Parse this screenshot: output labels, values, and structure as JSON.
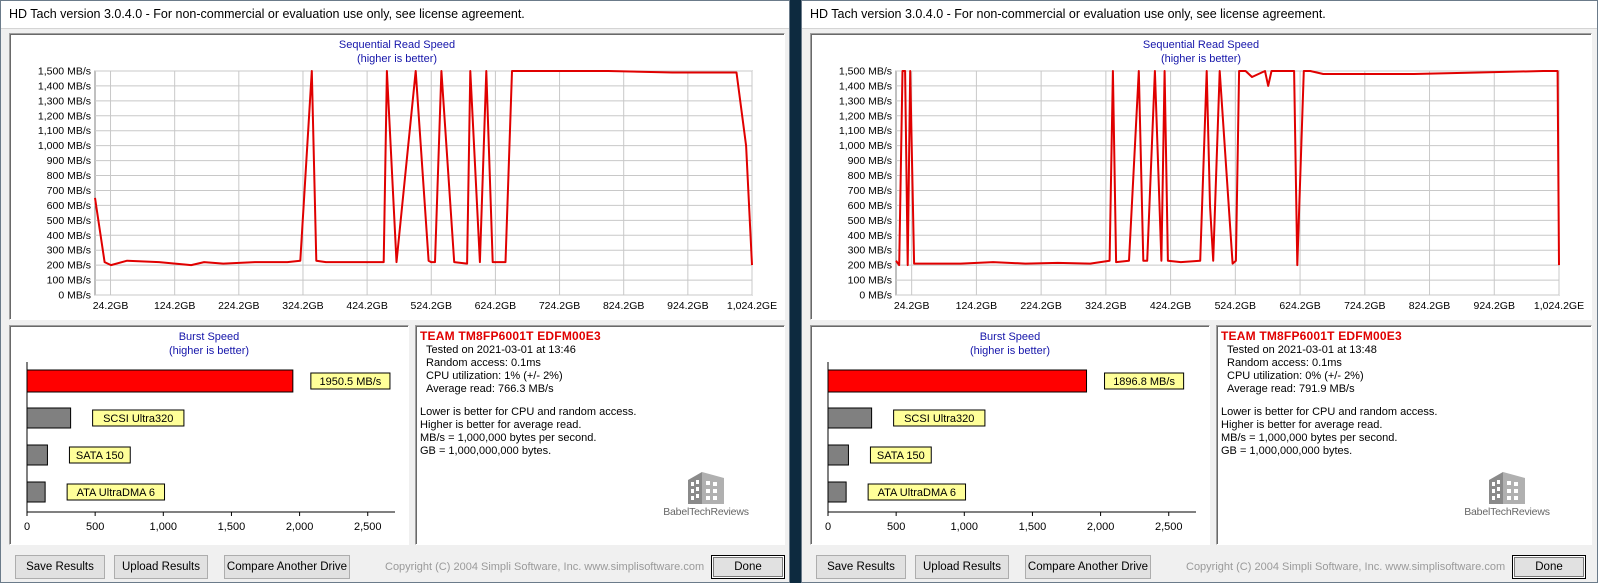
{
  "windows": [
    {
      "title": "HD Tach version 3.0.4.0  - For non-commercial or evaluation use only, see license agreement.",
      "seq_title": "Sequential Read Speed",
      "seq_subtitle": "(higher is better)",
      "burst_title": "Burst Speed",
      "burst_subtitle": "(higher is better)",
      "drive_name": "TEAM TM8FP6001T EDFM00E3",
      "info_lines": [
        "Tested on 2021-03-01 at 13:46",
        "Random access: 0.1ms",
        "CPU utilization: 1% (+/- 2%)",
        "Average read: 766.3 MB/s"
      ],
      "notes": [
        "Lower is better for CPU and random access.",
        "Higher is better for average read.",
        "MB/s = 1,000,000 bytes per second.",
        "GB = 1,000,000,000 bytes."
      ],
      "logo_text": "BabelTechReviews",
      "buttons": {
        "save": "Save Results",
        "upload": "Upload Results",
        "compare": "Compare Another Drive",
        "done": "Done"
      },
      "copyright": "Copyright (C) 2004 Simpli Software, Inc. www.simplisoftware.com"
    },
    {
      "title": "HD Tach version 3.0.4.0  - For non-commercial or evaluation use only, see license agreement.",
      "seq_title": "Sequential Read Speed",
      "seq_subtitle": "(higher is better)",
      "burst_title": "Burst Speed",
      "burst_subtitle": "(higher is better)",
      "drive_name": "TEAM TM8FP6001T EDFM00E3",
      "info_lines": [
        "Tested on 2021-03-01 at 13:48",
        "Random access: 0.1ms",
        "CPU utilization: 0% (+/- 2%)",
        "Average read: 791.9 MB/s"
      ],
      "notes": [
        "Lower is better for CPU and random access.",
        "Higher is better for average read.",
        "MB/s = 1,000,000 bytes per second.",
        "GB = 1,000,000,000 bytes."
      ],
      "logo_text": "BabelTechReviews",
      "buttons": {
        "save": "Save Results",
        "upload": "Upload Results",
        "compare": "Compare Another Drive",
        "done": "Done"
      },
      "copyright": "Copyright (C) 2004 Simpli Software, Inc. www.simplisoftware.com"
    }
  ],
  "chart_data": [
    {
      "type": "line",
      "title": "Sequential Read Speed",
      "subtitle": "(higher is better)",
      "ylim": [
        0,
        1500
      ],
      "xlim": [
        0,
        1024.2
      ],
      "y_ticks": [
        0,
        100,
        200,
        300,
        400,
        500,
        600,
        700,
        800,
        900,
        1000,
        1100,
        1200,
        1300,
        1400,
        1500
      ],
      "y_tick_labels": [
        "0 MB/s",
        "100 MB/s",
        "200 MB/s",
        "300 MB/s",
        "400 MB/s",
        "500 MB/s",
        "600 MB/s",
        "700 MB/s",
        "800 MB/s",
        "900 MB/s",
        "1,000 MB/s",
        "1,100 MB/s",
        "1,200 MB/s",
        "1,300 MB/s",
        "1,400 MB/s",
        "1,500 MB/s"
      ],
      "x_ticks": [
        24.2,
        124.2,
        224.2,
        324.2,
        424.2,
        524.2,
        624.2,
        724.2,
        824.2,
        924.2,
        1024.2
      ],
      "x_tick_labels": [
        "24.2GB",
        "124.2GB",
        "224.2GB",
        "324.2GB",
        "424.2GB",
        "524.2GB",
        "624.2GB",
        "724.2GB",
        "824.2GB",
        "924.2GB",
        "1,024.2GE"
      ],
      "grid": true,
      "series": [
        {
          "color": "#e00000",
          "x": [
            0,
            15,
            25,
            50,
            100,
            150,
            170,
            200,
            250,
            300,
            320,
            338,
            345,
            360,
            370,
            385,
            450,
            455,
            470,
            500,
            520,
            524,
            530,
            540,
            560,
            580,
            585,
            600,
            610,
            620,
            640,
            650,
            700,
            800,
            900,
            1000,
            1015,
            1024.2
          ],
          "y": [
            650,
            220,
            200,
            230,
            220,
            200,
            220,
            210,
            220,
            220,
            230,
            1500,
            230,
            220,
            220,
            220,
            220,
            1500,
            220,
            1500,
            230,
            220,
            220,
            1500,
            220,
            210,
            1500,
            220,
            1500,
            220,
            220,
            1500,
            1500,
            1500,
            1490,
            1490,
            1000,
            200
          ]
        }
      ]
    },
    {
      "type": "line",
      "title": "Sequential Read Speed",
      "subtitle": "(higher is better)",
      "ylim": [
        0,
        1500
      ],
      "xlim": [
        0,
        1024.2
      ],
      "y_ticks": [
        0,
        100,
        200,
        300,
        400,
        500,
        600,
        700,
        800,
        900,
        1000,
        1100,
        1200,
        1300,
        1400,
        1500
      ],
      "y_tick_labels": [
        "0 MB/s",
        "100 MB/s",
        "200 MB/s",
        "300 MB/s",
        "400 MB/s",
        "500 MB/s",
        "600 MB/s",
        "700 MB/s",
        "800 MB/s",
        "900 MB/s",
        "1,000 MB/s",
        "1,100 MB/s",
        "1,200 MB/s",
        "1,300 MB/s",
        "1,400 MB/s",
        "1,500 MB/s"
      ],
      "x_ticks": [
        24.2,
        124.2,
        224.2,
        324.2,
        424.2,
        524.2,
        624.2,
        724.2,
        824.2,
        924.2,
        1024.2
      ],
      "x_tick_labels": [
        "24.2GB",
        "124.2GB",
        "224.2GB",
        "324.2GB",
        "424.2GB",
        "524.2GB",
        "624.2GB",
        "724.2GB",
        "824.2GB",
        "924.2GB",
        "1,024.2GE"
      ],
      "grid": true,
      "series": [
        {
          "color": "#e00000",
          "x": [
            0,
            5,
            10,
            14,
            18,
            22,
            28,
            35,
            60,
            100,
            150,
            200,
            250,
            300,
            330,
            335,
            340,
            360,
            375,
            382,
            388,
            400,
            410,
            415,
            420,
            440,
            470,
            480,
            485,
            490,
            500,
            520,
            525,
            530,
            540,
            550,
            570,
            575,
            580,
            600,
            615,
            620,
            630,
            640,
            660,
            700,
            800,
            900,
            1000,
            1022,
            1024.2
          ],
          "y": [
            230,
            200,
            1500,
            1500,
            200,
            1500,
            210,
            210,
            210,
            210,
            220,
            210,
            215,
            210,
            230,
            1500,
            220,
            230,
            1500,
            230,
            230,
            1500,
            230,
            1500,
            230,
            220,
            230,
            1500,
            600,
            230,
            1500,
            210,
            230,
            1500,
            1500,
            1460,
            1500,
            1400,
            1500,
            1500,
            1500,
            200,
            1500,
            1500,
            1480,
            1480,
            1480,
            1490,
            1500,
            1500,
            200
          ]
        }
      ]
    },
    {
      "type": "bar",
      "title": "Burst Speed",
      "subtitle": "(higher is better)",
      "orientation": "horizontal",
      "xlim": [
        0,
        2700
      ],
      "x_ticks": [
        0,
        500,
        1000,
        1500,
        2000,
        2500
      ],
      "x_tick_labels": [
        "0",
        "500",
        "1,000",
        "1,500",
        "2,000",
        "2,500"
      ],
      "categories": [
        "1950.5 MB/s",
        "SCSI Ultra320",
        "SATA 150",
        "ATA UltraDMA 6"
      ],
      "values": [
        1950.5,
        320,
        150,
        133
      ],
      "colors": [
        "#ff0000",
        "#808080",
        "#808080",
        "#808080"
      ]
    },
    {
      "type": "bar",
      "title": "Burst Speed",
      "subtitle": "(higher is better)",
      "orientation": "horizontal",
      "xlim": [
        0,
        2700
      ],
      "x_ticks": [
        0,
        500,
        1000,
        1500,
        2000,
        2500
      ],
      "x_tick_labels": [
        "0",
        "500",
        "1,000",
        "1,500",
        "2,000",
        "2,500"
      ],
      "categories": [
        "1896.8 MB/s",
        "SCSI Ultra320",
        "SATA 150",
        "ATA UltraDMA 6"
      ],
      "values": [
        1896.8,
        320,
        150,
        133
      ],
      "colors": [
        "#ff0000",
        "#808080",
        "#808080",
        "#808080"
      ]
    }
  ]
}
